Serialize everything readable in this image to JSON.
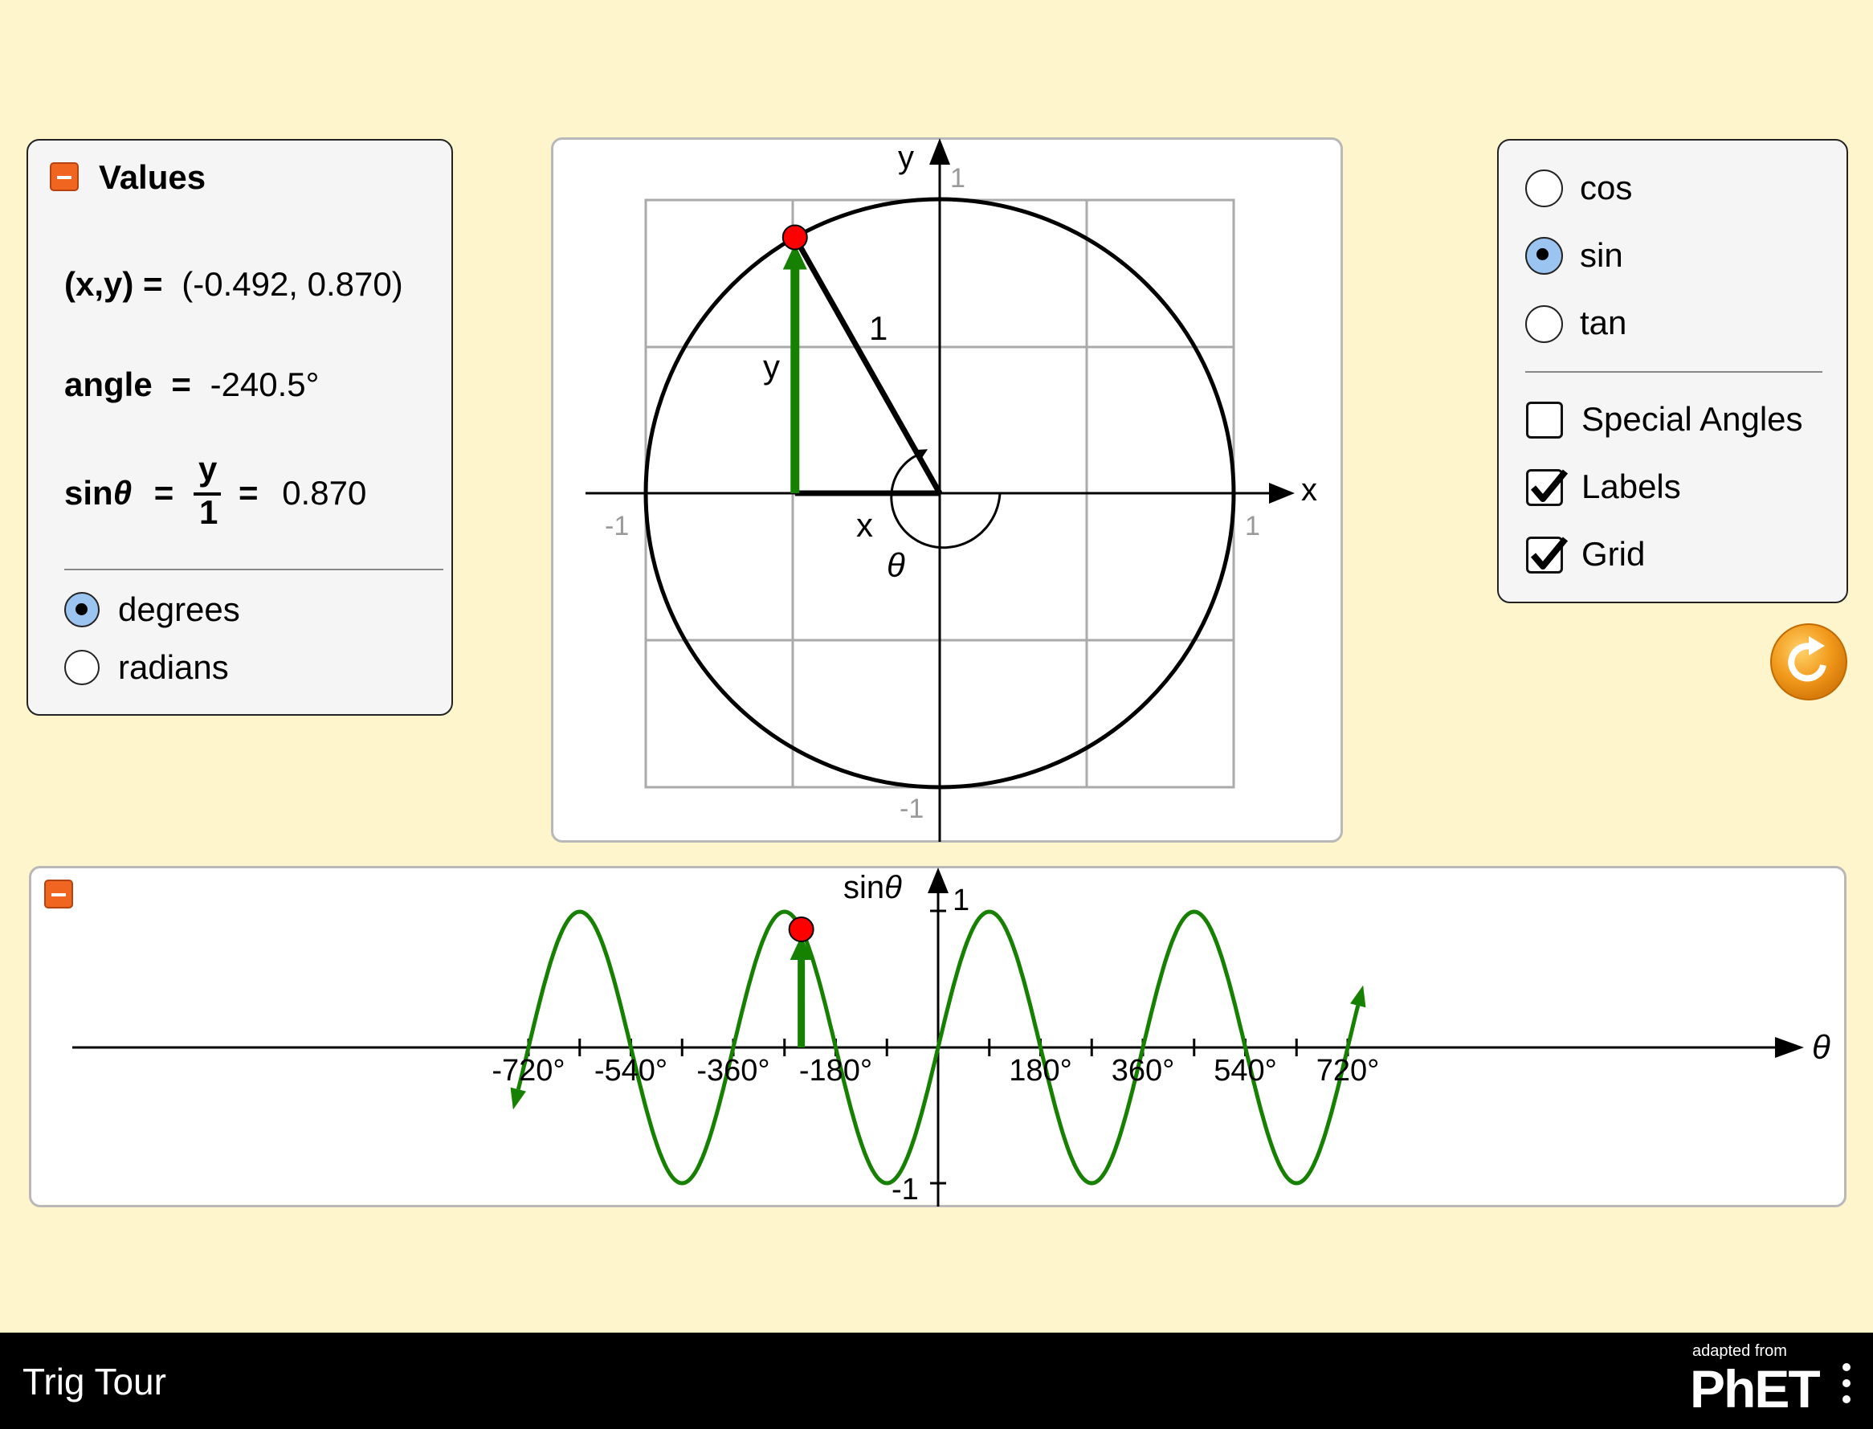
{
  "values_panel": {
    "title": "Values",
    "xy_label": "(x,y) =",
    "xy_value": "(-0.492, 0.870)",
    "angle_label": "angle",
    "angle_eq": "=",
    "angle_value": "-240.5°",
    "trig_label": "sin",
    "theta": "θ",
    "eq1": "=",
    "frac_num": "y",
    "frac_den": "1",
    "eq2": "=",
    "trig_value": "0.870",
    "degrees_label": "degrees",
    "radians_label": "radians",
    "selected_unit": "degrees"
  },
  "unit_circle": {
    "x_axis_label": "x",
    "y_axis_label": "y",
    "tick_pos_x": "1",
    "tick_neg_x": "-1",
    "tick_pos_y": "1",
    "tick_neg_y": "-1",
    "hyp_label": "1",
    "x_label": "x",
    "y_label": "y",
    "theta_label": "θ",
    "angle_deg": -240.5
  },
  "options_panel": {
    "cos_label": "cos",
    "sin_label": "sin",
    "tan_label": "tan",
    "selected_function": "sin",
    "special_angles_label": "Special Angles",
    "labels_label": "Labels",
    "grid_label": "Grid",
    "special_angles_checked": false,
    "labels_checked": true,
    "grid_checked": true
  },
  "graph": {
    "y_axis_title": "sin",
    "theta": "θ",
    "x_axis_symbol": "θ",
    "y_tick_top": "1",
    "y_tick_bottom": "-1",
    "tick_labels": [
      "-720°",
      "-540°",
      "-360°",
      "-180°",
      "180°",
      "360°",
      "540°",
      "720°"
    ]
  },
  "chart_data": {
    "type": "line",
    "title": "",
    "xlabel": "θ",
    "ylabel": "sinθ",
    "xlim": [
      -765,
      765
    ],
    "ylim": [
      -1,
      1
    ],
    "series": [
      {
        "values_function": "sin(θ)"
      }
    ],
    "current_point": {
      "x": -240.5,
      "y": 0.87
    },
    "x_ticks": [
      -720,
      -630,
      -540,
      -450,
      -360,
      -270,
      -180,
      -90,
      0,
      90,
      180,
      270,
      360,
      450,
      540,
      630,
      720
    ],
    "x_tick_labels": [
      "-720°",
      "-540°",
      "-360°",
      "-180°",
      "180°",
      "360°",
      "540°",
      "720°"
    ]
  },
  "colors": {
    "background": "#FFF5CC",
    "accent_green": "#168000",
    "point_red": "#FF0000",
    "collapse_orange": "#F0651F",
    "reset_orange": "#F29A1C",
    "radio_selected": "#9CC4F0"
  },
  "footer": {
    "sim_title": "Trig Tour",
    "adapted_from": "adapted from",
    "brand": "PhET"
  }
}
